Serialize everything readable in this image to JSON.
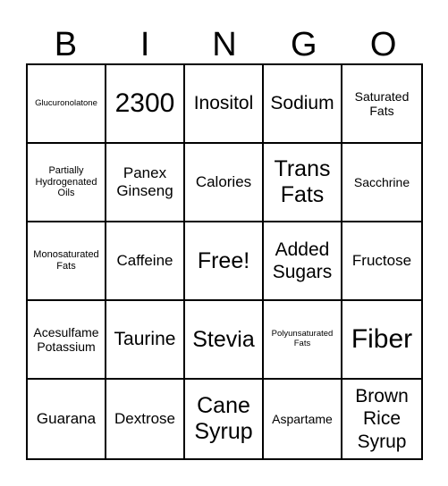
{
  "header": {
    "letters": [
      "B",
      "I",
      "N",
      "G",
      "O"
    ]
  },
  "card": {
    "rows": [
      [
        "Glucuronolatone",
        "2300",
        "Inositol",
        "Sodium",
        "Saturated Fats"
      ],
      [
        "Partially Hydrogenated Oils",
        "Panex Ginseng",
        "Calories",
        "Trans Fats",
        "Sacchrine"
      ],
      [
        "Monosaturated Fats",
        "Caffeine",
        "Free!",
        "Added Sugars",
        "Fructose"
      ],
      [
        "Acesulfame Potassium",
        "Taurine",
        "Stevia",
        "Polyunsaturated Fats",
        "Fiber"
      ],
      [
        "Guarana",
        "Dextrose",
        "Cane Syrup",
        "Aspartame",
        "Brown Rice Syrup"
      ]
    ]
  }
}
